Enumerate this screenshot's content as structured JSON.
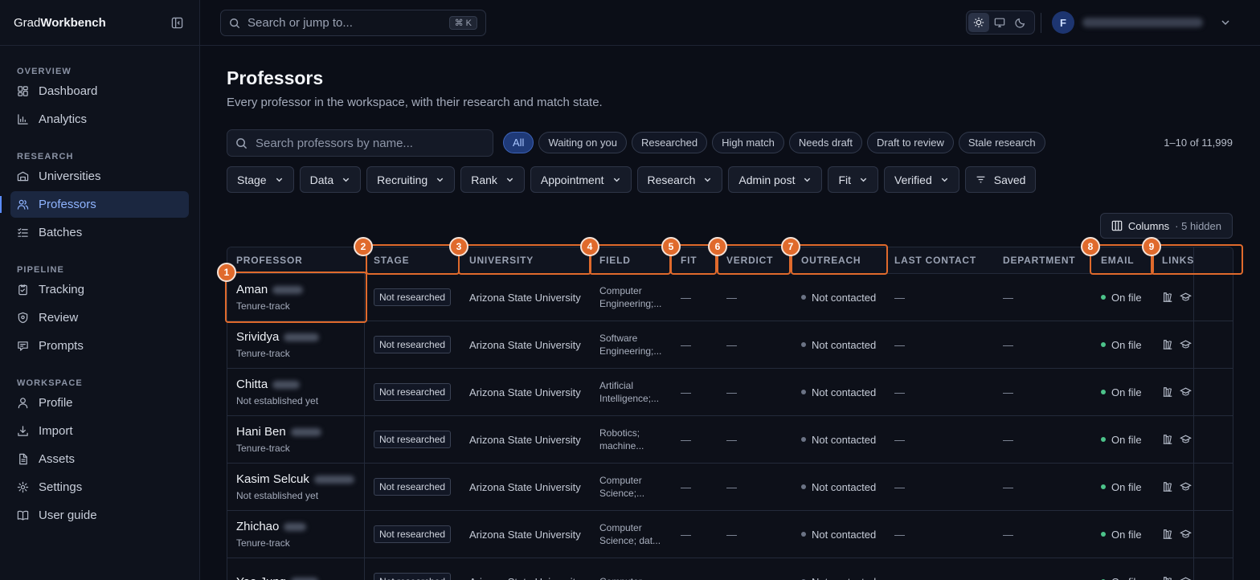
{
  "brand": {
    "prefix": "Grad",
    "bold": "Workbench"
  },
  "sidebar": {
    "sections": [
      {
        "heading": "OVERVIEW",
        "items": [
          {
            "label": "Dashboard",
            "icon": "dashboard-icon"
          },
          {
            "label": "Analytics",
            "icon": "analytics-icon"
          }
        ]
      },
      {
        "heading": "RESEARCH",
        "items": [
          {
            "label": "Universities",
            "icon": "universities-icon"
          },
          {
            "label": "Professors",
            "icon": "professors-icon",
            "active": true
          },
          {
            "label": "Batches",
            "icon": "batches-icon"
          }
        ]
      },
      {
        "heading": "PIPELINE",
        "items": [
          {
            "label": "Tracking",
            "icon": "tracking-icon"
          },
          {
            "label": "Review",
            "icon": "review-icon"
          },
          {
            "label": "Prompts",
            "icon": "prompts-icon"
          }
        ]
      },
      {
        "heading": "WORKSPACE",
        "items": [
          {
            "label": "Profile",
            "icon": "profile-icon"
          },
          {
            "label": "Import",
            "icon": "import-icon"
          },
          {
            "label": "Assets",
            "icon": "assets-icon"
          },
          {
            "label": "Settings",
            "icon": "settings-icon"
          },
          {
            "label": "User guide",
            "icon": "user-guide-icon"
          }
        ]
      }
    ]
  },
  "topbar": {
    "search_placeholder": "Search or jump to...",
    "shortcut": "⌘ K",
    "avatar_initial": "F"
  },
  "page": {
    "title": "Professors",
    "subtitle": "Every professor in the workspace, with their research and match state.",
    "search_placeholder": "Search professors by name...",
    "chips": [
      "All",
      "Waiting on you",
      "Researched",
      "High match",
      "Needs draft",
      "Draft to review",
      "Stale research"
    ],
    "active_chip": "All",
    "count": "1–10 of 11,999",
    "filters": [
      "Stage",
      "Data",
      "Recruiting",
      "Rank",
      "Appointment",
      "Research",
      "Admin post",
      "Fit",
      "Verified"
    ],
    "saved_label": "Saved",
    "columns_label": "Columns",
    "columns_hidden": "· 5 hidden"
  },
  "table": {
    "headers": [
      "PROFESSOR",
      "STAGE",
      "UNIVERSITY",
      "FIELD",
      "FIT",
      "VERDICT",
      "OUTREACH",
      "LAST CONTACT",
      "DEPARTMENT",
      "EMAIL",
      "LINKS"
    ],
    "rows": [
      {
        "name": "Aman",
        "appointment": "Tenure-track",
        "stage": "Not researched",
        "university": "Arizona State University",
        "field": "Computer Engineering;...",
        "fit": "—",
        "verdict": "—",
        "outreach": "Not contacted",
        "last_contact": "—",
        "department": "—",
        "email": "On file"
      },
      {
        "name": "Srividya",
        "appointment": "Tenure-track",
        "stage": "Not researched",
        "university": "Arizona State University",
        "field": "Software Engineering;...",
        "fit": "—",
        "verdict": "—",
        "outreach": "Not contacted",
        "last_contact": "—",
        "department": "—",
        "email": "On file"
      },
      {
        "name": "Chitta",
        "appointment": "Not established yet",
        "stage": "Not researched",
        "university": "Arizona State University",
        "field": "Artificial Intelligence;...",
        "fit": "—",
        "verdict": "—",
        "outreach": "Not contacted",
        "last_contact": "—",
        "department": "—",
        "email": "On file"
      },
      {
        "name": "Hani Ben",
        "appointment": "Tenure-track",
        "stage": "Not researched",
        "university": "Arizona State University",
        "field": "Robotics; machine...",
        "fit": "—",
        "verdict": "—",
        "outreach": "Not contacted",
        "last_contact": "—",
        "department": "—",
        "email": "On file"
      },
      {
        "name": "Kasim Selcuk",
        "appointment": "Not established yet",
        "stage": "Not researched",
        "university": "Arizona State University",
        "field": "Computer Science;...",
        "fit": "—",
        "verdict": "—",
        "outreach": "Not contacted",
        "last_contact": "—",
        "department": "—",
        "email": "On file"
      },
      {
        "name": "Zhichao",
        "appointment": "Tenure-track",
        "stage": "Not researched",
        "university": "Arizona State University",
        "field": "Computer Science; dat...",
        "fit": "—",
        "verdict": "—",
        "outreach": "Not contacted",
        "last_contact": "—",
        "department": "—",
        "email": "On file"
      },
      {
        "name": "Yoo Jung",
        "appointment": "",
        "stage": "Not researched",
        "university": "Arizona State University",
        "field": "Computer",
        "fit": "—",
        "verdict": "—",
        "outreach": "Not contacted",
        "last_contact": "—",
        "department": "—",
        "email": "On file"
      }
    ]
  },
  "annotations": [
    "1",
    "2",
    "3",
    "4",
    "5",
    "6",
    "7",
    "8",
    "9"
  ],
  "colors": {
    "accent": "#5b8cff",
    "annotation": "#e06a2c",
    "on_file": "#4cc38a"
  }
}
